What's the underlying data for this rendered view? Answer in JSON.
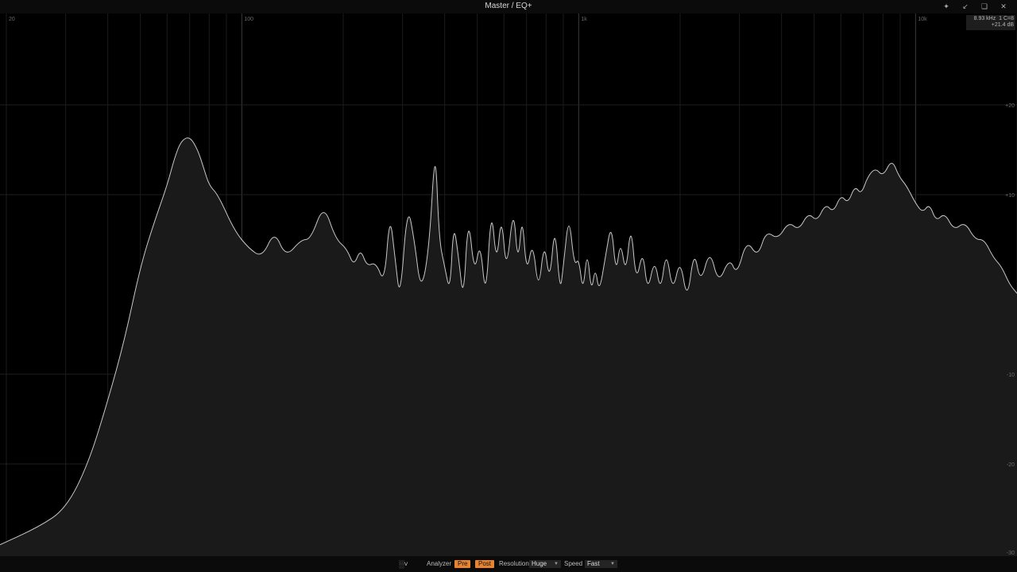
{
  "window": {
    "title": "Master / EQ+",
    "pin_icon": "pin-icon",
    "minimize_icon": "collapse-icon",
    "restore_icon": "restore-icon",
    "close_icon": "close-icon"
  },
  "readout": {
    "frequency": "8.93 kHz",
    "channel": "1 C=8",
    "gain": "+21.4 dB"
  },
  "axes": {
    "x_ticks": [
      {
        "label": "20",
        "value": 20
      },
      {
        "label": "100",
        "value": 100
      },
      {
        "label": "1k",
        "value": 1000
      },
      {
        "label": "10k",
        "value": 10000
      }
    ],
    "y_ticks": [
      {
        "label": "+20",
        "value": 20
      },
      {
        "label": "+10",
        "value": 10
      },
      {
        "label": "-10",
        "value": -10
      },
      {
        "label": "-20",
        "value": -20
      },
      {
        "label": "-30",
        "value": -30
      }
    ]
  },
  "colors": {
    "background": "#000000",
    "spectrum_fill": "#1a1a1a",
    "spectrum_line": "#c8c8c8",
    "accent": "#e8832f"
  },
  "toolbar": {
    "analyzer_icon": "analyzer-icon",
    "analyzer_label": "Analyzer",
    "pre_label": "Pre",
    "post_label": "Post",
    "resolution_label": "Resolution",
    "resolution_value": "Huge",
    "speed_label": "Speed",
    "speed_value": "Fast"
  },
  "spectrum": {
    "points": [
      [
        20,
        -29
      ],
      [
        25,
        -27
      ],
      [
        30,
        -25
      ],
      [
        35,
        -20
      ],
      [
        40,
        -13
      ],
      [
        45,
        -6
      ],
      [
        50,
        2
      ],
      [
        55,
        7
      ],
      [
        60,
        11
      ],
      [
        63,
        14
      ],
      [
        66,
        16
      ],
      [
        70,
        16.5
      ],
      [
        74,
        15
      ],
      [
        77,
        13
      ],
      [
        80,
        11
      ],
      [
        85,
        10
      ],
      [
        95,
        6
      ],
      [
        105,
        4
      ],
      [
        115,
        3
      ],
      [
        125,
        6
      ],
      [
        135,
        3
      ],
      [
        150,
        5
      ],
      [
        160,
        5
      ],
      [
        175,
        9
      ],
      [
        190,
        5
      ],
      [
        205,
        4
      ],
      [
        215,
        2
      ],
      [
        225,
        4
      ],
      [
        235,
        2
      ],
      [
        250,
        2.5
      ],
      [
        265,
        0
      ],
      [
        275,
        8
      ],
      [
        285,
        3
      ],
      [
        295,
        -2
      ],
      [
        310,
        9
      ],
      [
        325,
        5
      ],
      [
        340,
        -1
      ],
      [
        360,
        4
      ],
      [
        375,
        16
      ],
      [
        385,
        5
      ],
      [
        400,
        2
      ],
      [
        415,
        -1
      ],
      [
        425,
        7
      ],
      [
        440,
        3
      ],
      [
        455,
        -2
      ],
      [
        470,
        8
      ],
      [
        490,
        1
      ],
      [
        510,
        5
      ],
      [
        530,
        -2
      ],
      [
        550,
        9
      ],
      [
        570,
        2
      ],
      [
        590,
        8
      ],
      [
        610,
        1
      ],
      [
        640,
        9
      ],
      [
        660,
        2
      ],
      [
        680,
        8
      ],
      [
        700,
        1
      ],
      [
        730,
        5
      ],
      [
        760,
        -1
      ],
      [
        790,
        5
      ],
      [
        820,
        0
      ],
      [
        850,
        7
      ],
      [
        880,
        -1
      ],
      [
        900,
        2
      ],
      [
        935,
        8
      ],
      [
        970,
        2
      ],
      [
        1000,
        3
      ],
      [
        1030,
        -1
      ],
      [
        1060,
        4
      ],
      [
        1090,
        -1
      ],
      [
        1120,
        2
      ],
      [
        1150,
        -1
      ],
      [
        1200,
        3
      ],
      [
        1250,
        7
      ],
      [
        1290,
        1
      ],
      [
        1330,
        5
      ],
      [
        1380,
        1
      ],
      [
        1430,
        7
      ],
      [
        1480,
        0
      ],
      [
        1550,
        4
      ],
      [
        1600,
        -1
      ],
      [
        1680,
        3
      ],
      [
        1750,
        -1
      ],
      [
        1820,
        4
      ],
      [
        1900,
        -1
      ],
      [
        2000,
        3
      ],
      [
        2100,
        -2
      ],
      [
        2200,
        4
      ],
      [
        2300,
        0
      ],
      [
        2450,
        4
      ],
      [
        2600,
        0
      ],
      [
        2800,
        3
      ],
      [
        2950,
        1
      ],
      [
        3150,
        5
      ],
      [
        3400,
        3
      ],
      [
        3600,
        6
      ],
      [
        3900,
        5
      ],
      [
        4200,
        7
      ],
      [
        4500,
        6
      ],
      [
        4800,
        8
      ],
      [
        5100,
        7
      ],
      [
        5400,
        9
      ],
      [
        5700,
        8
      ],
      [
        6000,
        10
      ],
      [
        6300,
        9
      ],
      [
        6600,
        11
      ],
      [
        6900,
        10
      ],
      [
        7200,
        12
      ],
      [
        7600,
        13
      ],
      [
        8000,
        12
      ],
      [
        8500,
        14
      ],
      [
        8930,
        12
      ],
      [
        9400,
        11
      ],
      [
        10000,
        9
      ],
      [
        10500,
        8
      ],
      [
        11000,
        9
      ],
      [
        11500,
        7
      ],
      [
        12200,
        8
      ],
      [
        13000,
        6
      ],
      [
        14000,
        7
      ],
      [
        15000,
        5
      ],
      [
        16000,
        5
      ],
      [
        17000,
        3
      ],
      [
        18000,
        2
      ],
      [
        19000,
        0
      ],
      [
        20000,
        -1
      ]
    ]
  }
}
